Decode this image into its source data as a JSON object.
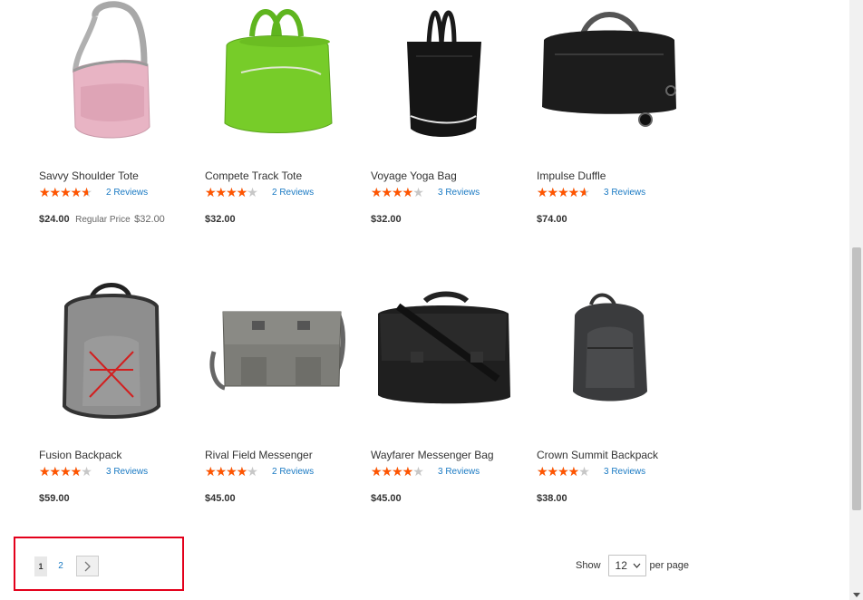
{
  "products": [
    {
      "name": "Savvy Shoulder Tote",
      "rating": 0.8,
      "reviews": "2 Reviews",
      "price": "$24.00",
      "regular_label": "Regular Price",
      "regular_price": "$32.00",
      "image_icon": "pink-shoulder-tote-icon"
    },
    {
      "name": "Compete Track Tote",
      "rating": 0.7,
      "reviews": "2 Reviews",
      "price": "$32.00",
      "image_icon": "green-track-tote-icon"
    },
    {
      "name": "Voyage Yoga Bag",
      "rating": 0.67,
      "reviews": "3 Reviews",
      "price": "$32.00",
      "image_icon": "black-yoga-bag-icon"
    },
    {
      "name": "Impulse Duffle",
      "rating": 0.8,
      "reviews": "3 Reviews",
      "price": "$74.00",
      "image_icon": "black-duffle-icon"
    },
    {
      "name": "Fusion Backpack",
      "rating": 0.67,
      "reviews": "3 Reviews",
      "price": "$59.00",
      "image_icon": "gray-backpack-icon"
    },
    {
      "name": "Rival Field Messenger",
      "rating": 0.7,
      "reviews": "2 Reviews",
      "price": "$45.00",
      "image_icon": "gray-messenger-icon"
    },
    {
      "name": "Wayfarer Messenger Bag",
      "rating": 0.67,
      "reviews": "3 Reviews",
      "price": "$45.00",
      "image_icon": "black-messenger-icon"
    },
    {
      "name": "Crown Summit Backpack",
      "rating": 0.67,
      "reviews": "3 Reviews",
      "price": "$38.00",
      "image_icon": "dark-backpack-icon"
    }
  ],
  "pager": {
    "current": "1",
    "next_page": "2"
  },
  "limiter": {
    "label_before": "Show",
    "value": "12",
    "label_after": "per page"
  },
  "colors": {
    "star": "#ff5501",
    "star_empty": "#c7c7c7",
    "link": "#1979c3",
    "highlight": "#e3001b"
  }
}
